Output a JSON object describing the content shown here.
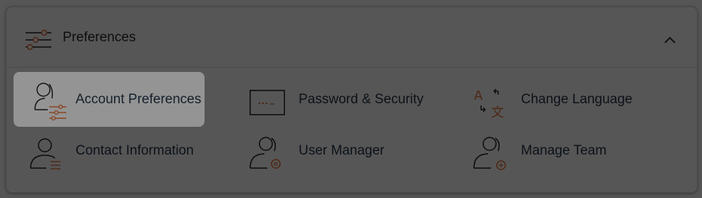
{
  "header": {
    "title": "Preferences",
    "icon": "sliders-icon",
    "collapse_icon": "chevron-up-icon"
  },
  "items": [
    {
      "label": "Account Preferences",
      "icon": "user-sliders-icon",
      "highlighted": true
    },
    {
      "label": "Password & Security",
      "icon": "password-field-icon",
      "highlighted": false
    },
    {
      "label": "Change Language",
      "icon": "translate-icon",
      "highlighted": false
    },
    {
      "label": "Contact Information",
      "icon": "user-list-icon",
      "highlighted": false
    },
    {
      "label": "User Manager",
      "icon": "users-gear-icon",
      "highlighted": false
    },
    {
      "label": "Manage Team",
      "icon": "user-add-icon",
      "highlighted": false
    }
  ],
  "colors": {
    "accent": "#e8753d",
    "icon_stroke": "#1f1f1f",
    "label": "#25374a"
  }
}
